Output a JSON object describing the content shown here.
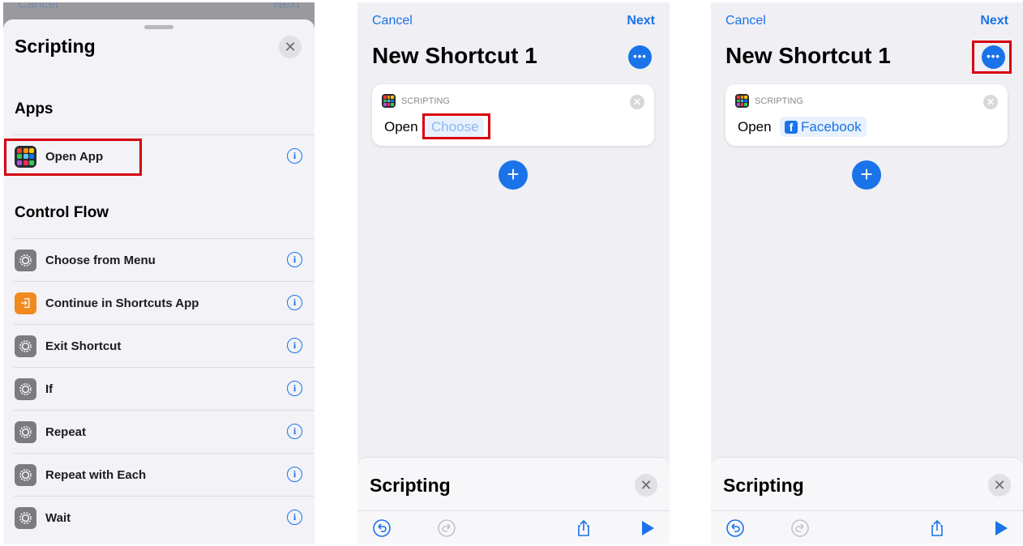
{
  "colors": {
    "accent": "#1a73e8",
    "highlight": "#d6000f",
    "gear_icon_bg": "#7b7b80",
    "orange_icon_bg": "#f08a1e"
  },
  "panel1": {
    "peek_cancel": "Cancel",
    "peek_next": "Next",
    "sheet_title": "Scripting",
    "close_glyph": "✕",
    "section_apps": "Apps",
    "apps_items": [
      {
        "label": "Open App",
        "icon": "app-grid-icon",
        "info": "i"
      }
    ],
    "section_control": "Control Flow",
    "control_items": [
      {
        "label": "Choose from Menu",
        "icon": "gear-icon",
        "info": "i"
      },
      {
        "label": "Continue in Shortcuts App",
        "icon": "continue-icon",
        "info": "i"
      },
      {
        "label": "Exit Shortcut",
        "icon": "gear-icon",
        "info": "i"
      },
      {
        "label": "If",
        "icon": "gear-icon",
        "info": "i"
      },
      {
        "label": "Repeat",
        "icon": "gear-icon",
        "info": "i"
      },
      {
        "label": "Repeat with Each",
        "icon": "gear-icon",
        "info": "i"
      },
      {
        "label": "Wait",
        "icon": "gear-icon",
        "info": "i"
      }
    ]
  },
  "panel2": {
    "cancel": "Cancel",
    "next": "Next",
    "title": "New Shortcut 1",
    "more_glyph": "•••",
    "card": {
      "category": "SCRIPTING",
      "verb": "Open",
      "param": "Choose",
      "remove_glyph": "✕"
    },
    "add_glyph": "+",
    "drawer_title": "Scripting",
    "close_glyph": "✕"
  },
  "panel3": {
    "cancel": "Cancel",
    "next": "Next",
    "title": "New Shortcut 1",
    "more_glyph": "•••",
    "card": {
      "category": "SCRIPTING",
      "verb": "Open",
      "param": "Facebook",
      "param_icon": "f",
      "remove_glyph": "✕"
    },
    "add_glyph": "+",
    "drawer_title": "Scripting",
    "close_glyph": "✕"
  }
}
